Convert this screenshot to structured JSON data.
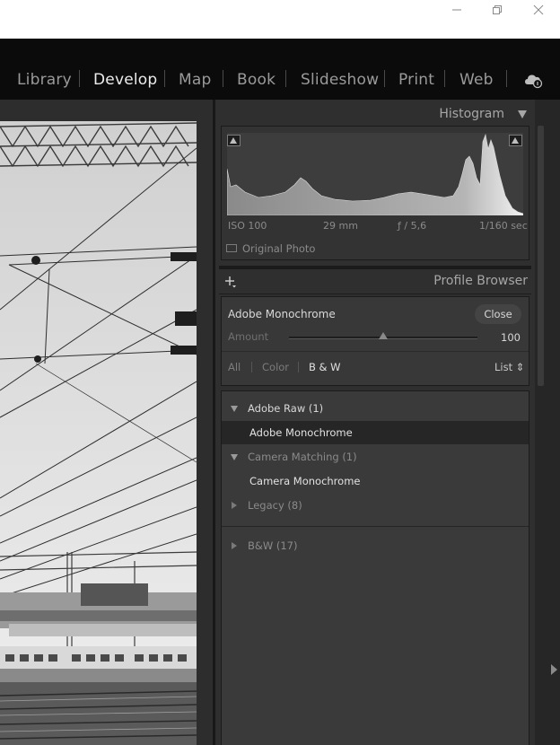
{
  "window": {
    "minimize_icon": "minimize-icon",
    "restore_icon": "restore-icon",
    "close_icon": "close-icon"
  },
  "modules": [
    {
      "label": "Library",
      "active": false
    },
    {
      "label": "Develop",
      "active": true
    },
    {
      "label": "Map",
      "active": false
    },
    {
      "label": "Book",
      "active": false
    },
    {
      "label": "Slideshow",
      "active": false
    },
    {
      "label": "Print",
      "active": false
    },
    {
      "label": "Web",
      "active": false
    }
  ],
  "cloud_icon": "cloud-sync-icon",
  "histogram": {
    "title": "Histogram",
    "iso": "ISO 100",
    "focal": "29 mm",
    "aperture": "ƒ / 5,6",
    "shutter": "1/160 sec",
    "original_photo": "Original Photo"
  },
  "profile_browser": {
    "title": "Profile Browser",
    "current_profile": "Adobe Monochrome",
    "close_label": "Close",
    "amount_label": "Amount",
    "amount_value": "100",
    "amount_fraction": 0.5,
    "filters": [
      {
        "label": "All",
        "active": false
      },
      {
        "label": "Color",
        "active": false
      },
      {
        "label": "B & W",
        "active": true
      }
    ],
    "sort_label": "List ⇕",
    "groups": [
      {
        "label": "Adobe Raw (1)",
        "expanded": true,
        "items": [
          "Adobe Monochrome"
        ]
      },
      {
        "label": "Camera Matching (1)",
        "expanded": true,
        "items": [
          "Camera Monochrome"
        ]
      },
      {
        "label": "Legacy (8)",
        "expanded": false,
        "items": []
      },
      {
        "label": "B&W (17)",
        "expanded": false,
        "items": []
      }
    ],
    "selected_item": "Adobe Monochrome"
  },
  "colors": {
    "panel": "#2f2f2f",
    "module_bar": "#0b0b0b",
    "selected_row": "#262626"
  }
}
